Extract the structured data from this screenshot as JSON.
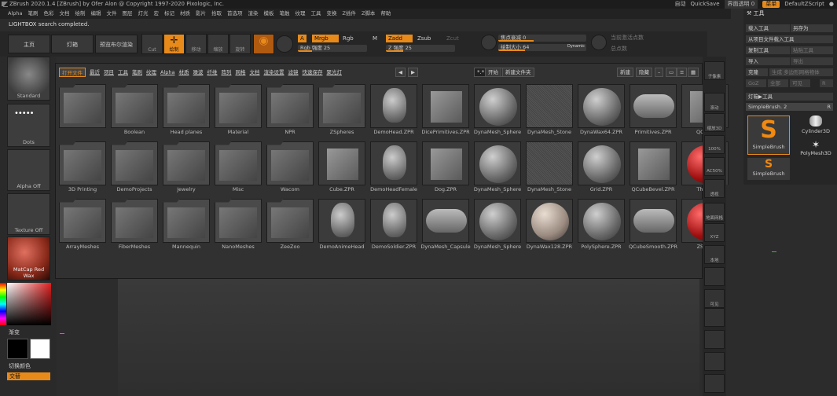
{
  "titlebar": {
    "text": "ZBrush 2020.1.4 [ZBrush] by Ofer Alon @ Copyright 1997-2020 Pixologic, Inc.",
    "quicksave_prefix": "自动",
    "quicksave": "QuickSave",
    "transparency": "界面透明 0",
    "menus_btn": "菜单",
    "script": "DefaultZScript"
  },
  "menubar": [
    "Alpha",
    "笔刷",
    "色彩",
    "文档",
    "绘制",
    "编辑",
    "文件",
    "图层",
    "灯光",
    "宏",
    "标记",
    "材质",
    "影片",
    "拾取",
    "首选项",
    "渲染",
    "模板",
    "笔触",
    "纹理",
    "工具",
    "变换",
    "Z插件",
    "Z脚本",
    "帮助"
  ],
  "notice": "LIGHTBOX search completed.",
  "topbar": {
    "home": "主页",
    "lightbox": "灯箱",
    "preview_render": "预览布尔渲染",
    "cut": "Cut",
    "draw": "绘制",
    "move": "移动",
    "scale": "缩放",
    "rotate": "旋转",
    "a_label": "A",
    "mrgb": "Mrgb",
    "rgb": "Rgb",
    "m": "M",
    "rgb_strength": "Rgb 强度 25",
    "zadd": "Zadd",
    "zsub": "Zsub",
    "zcut": "Zcut",
    "z_strength": "Z 强度 25",
    "focal": "焦点衰减 0",
    "draw_size": "绘制大小 64",
    "dynamic": "Dynamic",
    "active_points": "当前激活点数",
    "total_points": "总点数"
  },
  "lightbox": {
    "tabs": [
      "打开文件",
      "最近",
      "项目",
      "工具",
      "笔刷",
      "纹理",
      "Alpha",
      "材质",
      "噪波",
      "纤维",
      "阵列",
      "网格",
      "文档",
      "渲染设置",
      "滤镜",
      "快速保存",
      "聚光灯"
    ],
    "search": "*.*",
    "start": "开始",
    "new_folder": "新建文件夹",
    "new": "新建",
    "hide": "隐藏",
    "rows": [
      [
        "",
        "Boolean",
        "Head planes",
        "Material",
        "NPR",
        "ZSpheres",
        "DemoHead.ZPR",
        "DicePrimitives.ZPR",
        "DynaMesh_Sphere",
        "DynaMesh_Stone",
        "DynaWax64.ZPR",
        "Primitives.ZPR",
        "QCube"
      ],
      [
        "3D Printing",
        "DemoProjects",
        "Jewelry",
        "Misc",
        "Wacom",
        "Cube.ZPR",
        "DemoHeadFemale",
        "Dog.ZPR",
        "DynaMesh_Sphere",
        "DynaMesh_Stone",
        "Grid.ZPR",
        "QCubeBevel.ZPR",
        "ThickP"
      ],
      [
        "ArrayMeshes",
        "FiberMeshes",
        "Mannequin",
        "NanoMeshes",
        "ZeeZoo",
        "DemoAnimeHead",
        "DemoSoldier.ZPR",
        "DynaMesh_Capsule",
        "DynaMesh_Sphere",
        "DynaWax128.ZPR",
        "PolySphere.ZPR",
        "QCubeSmooth.ZPR",
        "ZSphe"
      ]
    ]
  },
  "left": {
    "standard": "Standard",
    "dots": "Dots",
    "alpha_off": "Alpha Off",
    "texture_off": "Texture Off",
    "matcap": "MatCap Red Wax",
    "gradient": "渐变",
    "switch_color": "切换颜色",
    "alternate": "交替"
  },
  "tool_panel": {
    "title": "工具",
    "load": "载入工具",
    "save_as": "另存为",
    "load_project": "从项目文件载入工具",
    "copy": "复制工具",
    "paste": "粘贴工具",
    "import": "导入",
    "export": "导出",
    "clone": "克隆",
    "make_multi": "生成 多边形网格物体",
    "goz": "GoZ",
    "all": "全部",
    "visible": "可见",
    "r": "R",
    "lightbox_tools": "灯箱▶工具",
    "simplebrush": "SimpleBrush. 2",
    "b1": "SimpleBrush",
    "b2": "Cylinder3D",
    "b3": "PolyMesh3D",
    "b4": "SimpleBrush"
  },
  "rightstrip": [
    "子像素",
    "滚动",
    "缩放3D",
    "100%",
    "AC50%",
    "透视",
    "地面网格",
    "XYZ",
    "本地",
    "",
    "可见"
  ]
}
